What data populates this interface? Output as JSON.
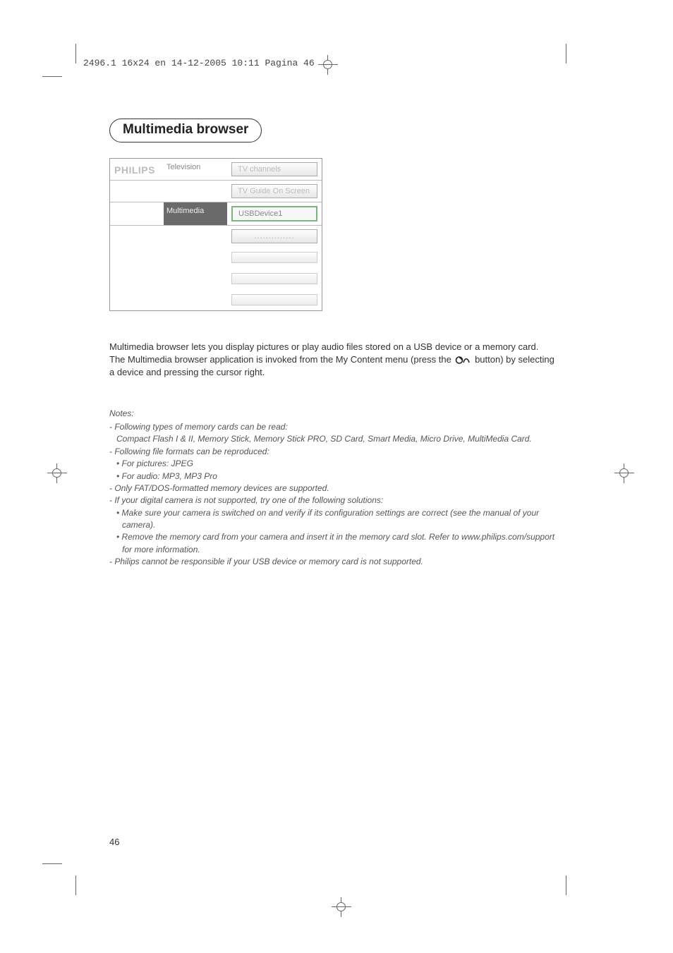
{
  "colors": {
    "header_text": "#444444",
    "body_text": "#333333"
  },
  "header": "2496.1 16x24 en  14-12-2005  10:11  Pagina 46",
  "section_title": "Multimedia browser",
  "ui_panel": {
    "brand": "PHILIPS",
    "left_col": {
      "row1": "Television",
      "row2": "Multimedia"
    },
    "right_col": {
      "tv_channels": "TV channels",
      "tv_guide": "TV Guide On Screen",
      "usb": "USBDevice1",
      "placeholder": ".............."
    }
  },
  "intro": {
    "p1": "Multimedia browser lets you display pictures or play audio files stored on a USB device or a memory card.",
    "p2a": "The Multimedia browser application is invoked from the My Content menu (press the ",
    "p2b": " button) by selecting a device and pressing the cursor right.",
    "icon_name": "my-content-icon"
  },
  "notes": {
    "header": "Notes:",
    "items": [
      {
        "lvl": 1,
        "text": "- Following types of memory cards can be read:"
      },
      {
        "lvl": 2,
        "text": "Compact Flash I & II, Memory Stick, Memory Stick PRO, SD Card, Smart Media, Micro Drive, MultiMedia Card."
      },
      {
        "lvl": 1,
        "text": "- Following file formats can be reproduced:"
      },
      {
        "lvl": 2,
        "text": "• For pictures: JPEG"
      },
      {
        "lvl": 2,
        "text": "• For audio: MP3, MP3 Pro"
      },
      {
        "lvl": 1,
        "text": "- Only FAT/DOS-formatted memory devices are supported."
      },
      {
        "lvl": 1,
        "text": "- If your digital camera is not supported, try one of the following solutions:"
      },
      {
        "lvl": 2,
        "text": "• Make sure your camera is switched on and verify if its configuration settings are correct (see the manual of your camera)."
      },
      {
        "lvl": 2,
        "text": "• Remove the memory card from your camera and insert it in the memory card slot. Refer to www.philips.com/support for more information."
      },
      {
        "lvl": 1,
        "text": "- Philips cannot be responsible if your USB device or memory card is not supported."
      }
    ]
  },
  "page_number": "46"
}
